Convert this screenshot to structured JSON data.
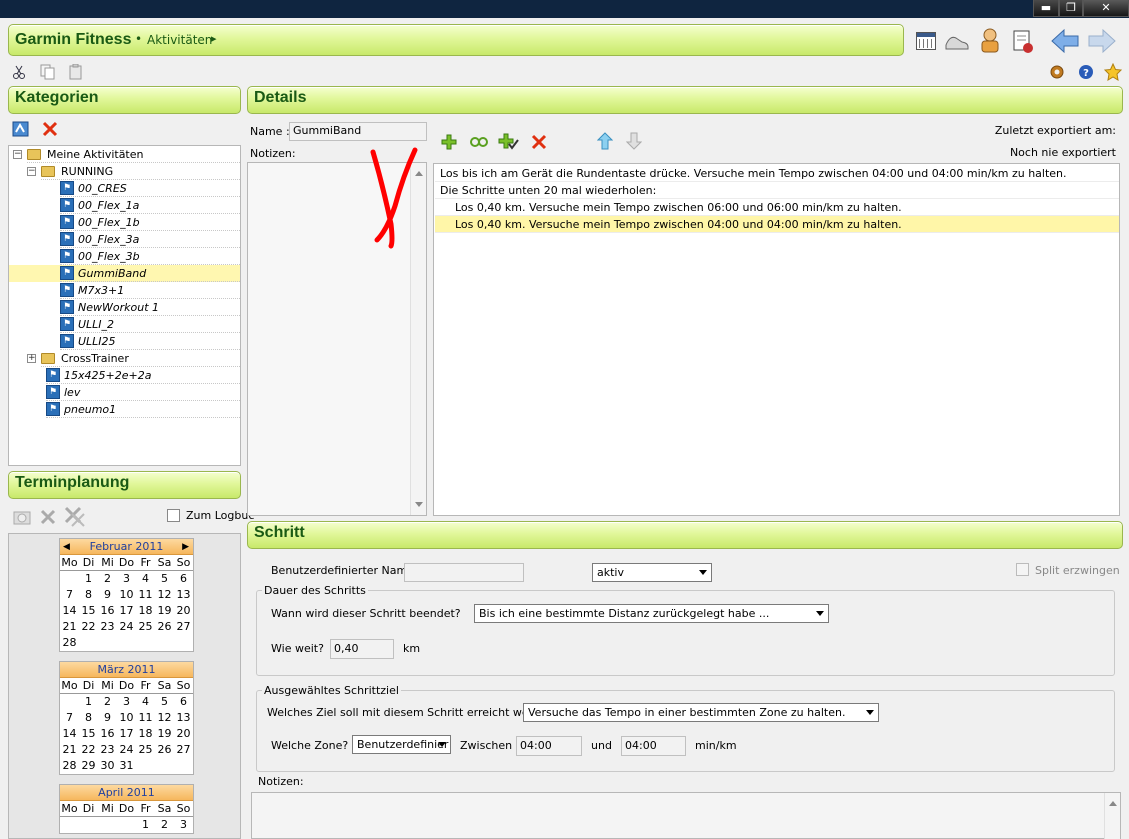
{
  "window": {
    "minimize": "▬",
    "restore": "❐",
    "close": "✕"
  },
  "header": {
    "app_title": "Garmin Fitness",
    "separator": "•",
    "breadcrumb": "Aktivitäten",
    "breadcrumb_arrow": "▸"
  },
  "toolbar_icons": [
    "calendar-icon",
    "shoe-icon",
    "user-icon",
    "report-icon",
    "back-arrow-icon",
    "forward-arrow-icon"
  ],
  "kategorien": {
    "title": "Kategorien",
    "tree": [
      {
        "label": "Meine Aktivitäten",
        "type": "folder",
        "level": 0
      },
      {
        "label": "RUNNING",
        "type": "folder",
        "level": 1
      },
      {
        "label": "00_CRES",
        "type": "workout",
        "level": 2
      },
      {
        "label": "00_Flex_1a",
        "type": "workout",
        "level": 2
      },
      {
        "label": "00_Flex_1b",
        "type": "workout",
        "level": 2
      },
      {
        "label": "00_Flex_3a",
        "type": "workout",
        "level": 2
      },
      {
        "label": "00_Flex_3b",
        "type": "workout",
        "level": 2
      },
      {
        "label": "GummiBand",
        "type": "workout",
        "level": 2,
        "selected": true
      },
      {
        "label": "M7x3+1",
        "type": "workout",
        "level": 2
      },
      {
        "label": "NewWorkout 1",
        "type": "workout",
        "level": 2
      },
      {
        "label": "ULLI_2",
        "type": "workout",
        "level": 2
      },
      {
        "label": "ULLI25",
        "type": "workout",
        "level": 2
      },
      {
        "label": "CrossTrainer",
        "type": "folder",
        "level": 1
      },
      {
        "label": "15x425+2e+2a",
        "type": "workout",
        "level": 1
      },
      {
        "label": "lev",
        "type": "workout",
        "level": 1
      },
      {
        "label": "pneumo1",
        "type": "workout",
        "level": 1
      }
    ]
  },
  "termin": {
    "title": "Terminplanung",
    "logbook_label": "Zum Logbuc",
    "weekdays": [
      "Mo",
      "Di",
      "Mi",
      "Do",
      "Fr",
      "Sa",
      "So"
    ],
    "months": [
      {
        "title": "Februar 2011",
        "days": [
          "",
          "1",
          "2",
          "3",
          "4",
          "5",
          "6",
          "7",
          "8",
          "9",
          "10",
          "11",
          "12",
          "13",
          "14",
          "15",
          "16",
          "17",
          "18",
          "19",
          "20",
          "21",
          "22",
          "23",
          "24",
          "25",
          "26",
          "27",
          "28"
        ]
      },
      {
        "title": "März 2011",
        "days": [
          "",
          "1",
          "2",
          "3",
          "4",
          "5",
          "6",
          "7",
          "8",
          "9",
          "10",
          "11",
          "12",
          "13",
          "14",
          "15",
          "16",
          "17",
          "18",
          "19",
          "20",
          "21",
          "22",
          "23",
          "24",
          "25",
          "26",
          "27",
          "28",
          "29",
          "30",
          "31"
        ]
      },
      {
        "title": "April 2011",
        "days": [
          "",
          "",
          "",
          "",
          "1",
          "2",
          "3"
        ]
      }
    ]
  },
  "details": {
    "title": "Details",
    "name_label": "Name :",
    "name_value": "GummiBand",
    "notes_label": "Notizen:",
    "exported_label": "Zuletzt exportiert am:",
    "exported_value": "Noch nie exportiert",
    "steps": [
      {
        "text": "Los bis ich am Gerät die Rundentaste drücke.  Versuche mein Tempo zwischen 04:00 und 04:00 min/km zu halten.",
        "indent": 0
      },
      {
        "text": "Die Schritte unten 20 mal wiederholen:",
        "indent": 0
      },
      {
        "text": "Los 0,40 km.  Versuche mein Tempo zwischen 06:00 und 06:00 min/km zu halten.",
        "indent": 1
      },
      {
        "text": "Los 0,40 km.  Versuche mein Tempo zwischen 04:00 und 04:00 min/km zu halten.",
        "indent": 1,
        "selected": true
      }
    ]
  },
  "schritt": {
    "title": "Schritt",
    "custom_name_label": "Benutzerdefinierter Name:",
    "custom_name_value": "",
    "status_value": "aktiv",
    "split_label": "Split erzwingen",
    "dauer_group": "Dauer des Schritts",
    "end_question": "Wann wird dieser Schritt beendet?",
    "end_value": "Bis ich eine bestimmte Distanz zurückgelegt habe ...",
    "distance_label": "Wie weit?",
    "distance_value": "0,40",
    "distance_unit": "km",
    "target_group": "Ausgewähltes Schrittziel",
    "target_question": "Welches Ziel soll mit diesem Schritt erreicht werden?",
    "target_value": "Versuche das Tempo in einer bestimmten Zone zu halten.",
    "zone_label": "Welche Zone?",
    "zone_value": "Benutzerdefinier",
    "between_label": "Zwischen",
    "from_value": "04:00",
    "and_label": "und",
    "to_value": "04:00",
    "pace_unit": "min/km",
    "notes_label": "Notizen:"
  }
}
